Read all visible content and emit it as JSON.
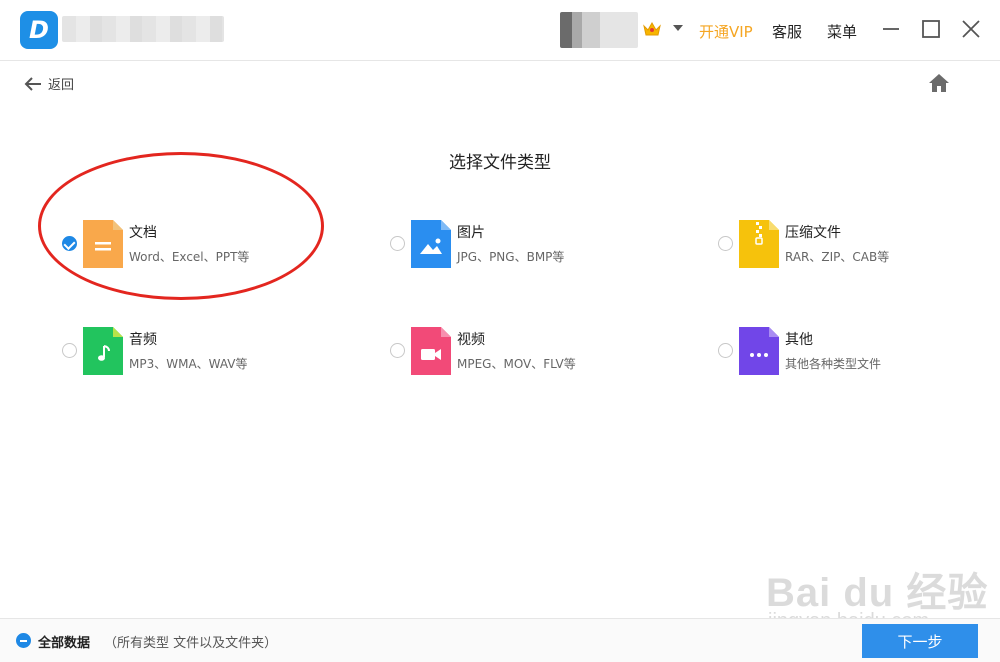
{
  "titlebar": {
    "vip_label": "开通VIP",
    "support_label": "客服",
    "menu_label": "菜单"
  },
  "nav": {
    "back_label": "返回"
  },
  "page": {
    "title": "选择文件类型"
  },
  "options": [
    {
      "label": "文档",
      "desc": "Word、Excel、PPT等",
      "checked": true,
      "color": "#f9a84b",
      "icon": "document-icon"
    },
    {
      "label": "图片",
      "desc": "JPG、PNG、BMP等",
      "checked": false,
      "color": "#2a8ef0",
      "icon": "image-icon"
    },
    {
      "label": "压缩文件",
      "desc": "RAR、ZIP、CAB等",
      "checked": false,
      "color": "#f6c20c",
      "icon": "zip-icon"
    },
    {
      "label": "音频",
      "desc": "MP3、WMA、WAV等",
      "checked": false,
      "color": "#22c45e",
      "icon": "music-icon"
    },
    {
      "label": "视频",
      "desc": "MPEG、MOV、FLV等",
      "checked": false,
      "color": "#f24a78",
      "icon": "video-icon"
    },
    {
      "label": "其他",
      "desc": "其他各种类型文件",
      "checked": false,
      "color": "#7146e8",
      "icon": "more-icon"
    }
  ],
  "footer": {
    "all_data_label": "全部数据",
    "all_data_desc": "（所有类型 文件以及文件夹）",
    "next_label": "下一步"
  },
  "watermark": {
    "main": "Bai du 经验",
    "sub": "jingyan.baidu.com"
  },
  "colors": {
    "accent": "#2f8fea",
    "vip": "#f5a623",
    "annotation": "#e3261f"
  }
}
